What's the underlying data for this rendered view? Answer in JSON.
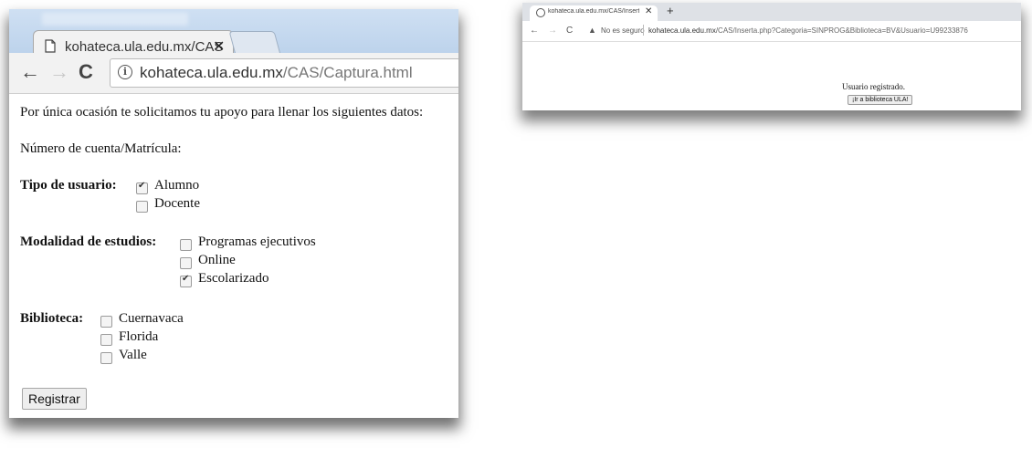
{
  "left_window": {
    "tab": {
      "title": "kohateca.ula.edu.mx/CAS",
      "close": "✕"
    },
    "nav": {
      "back": "←",
      "forward": "→",
      "reload": "C"
    },
    "url": {
      "host": "kohateca.ula.edu.mx",
      "path": "/CAS/Captura.html"
    },
    "info_icon": "i",
    "intro": "Por única ocasión te solicitamos tu apoyo para llenar los siguientes datos:",
    "account_label": "Número de cuenta/Matrícula:",
    "tipo_usuario": {
      "label": "Tipo de usuario:",
      "options": [
        {
          "label": "Alumno",
          "checked": true
        },
        {
          "label": "Docente",
          "checked": false
        }
      ]
    },
    "modalidad": {
      "label": "Modalidad de estudios:",
      "options": [
        {
          "label": "Programas ejecutivos",
          "checked": false
        },
        {
          "label": "Online",
          "checked": false
        },
        {
          "label": "Escolarizado",
          "checked": true
        }
      ]
    },
    "biblioteca": {
      "label": "Biblioteca:",
      "options": [
        {
          "label": "Cuernavaca",
          "checked": false
        },
        {
          "label": "Florida",
          "checked": false
        },
        {
          "label": "Valle",
          "checked": false
        }
      ]
    },
    "submit_label": "Registrar"
  },
  "right_window": {
    "tab": {
      "title": "kohateca.ula.edu.mx/CAS/Inserta",
      "close": "✕"
    },
    "new_tab": "+",
    "nav": {
      "back": "←",
      "forward": "→",
      "reload": "C"
    },
    "warning": "▲",
    "not_secure": "No es seguro",
    "url": {
      "host": "kohateca.ula.edu.mx",
      "path": "/CAS/Inserta.php?Categoria=SINPROG&Biblioteca=BV&Usuario=U99233876"
    },
    "message": "Usuario registrado.",
    "button_label": "¡Ir a biblioteca ULA!"
  }
}
